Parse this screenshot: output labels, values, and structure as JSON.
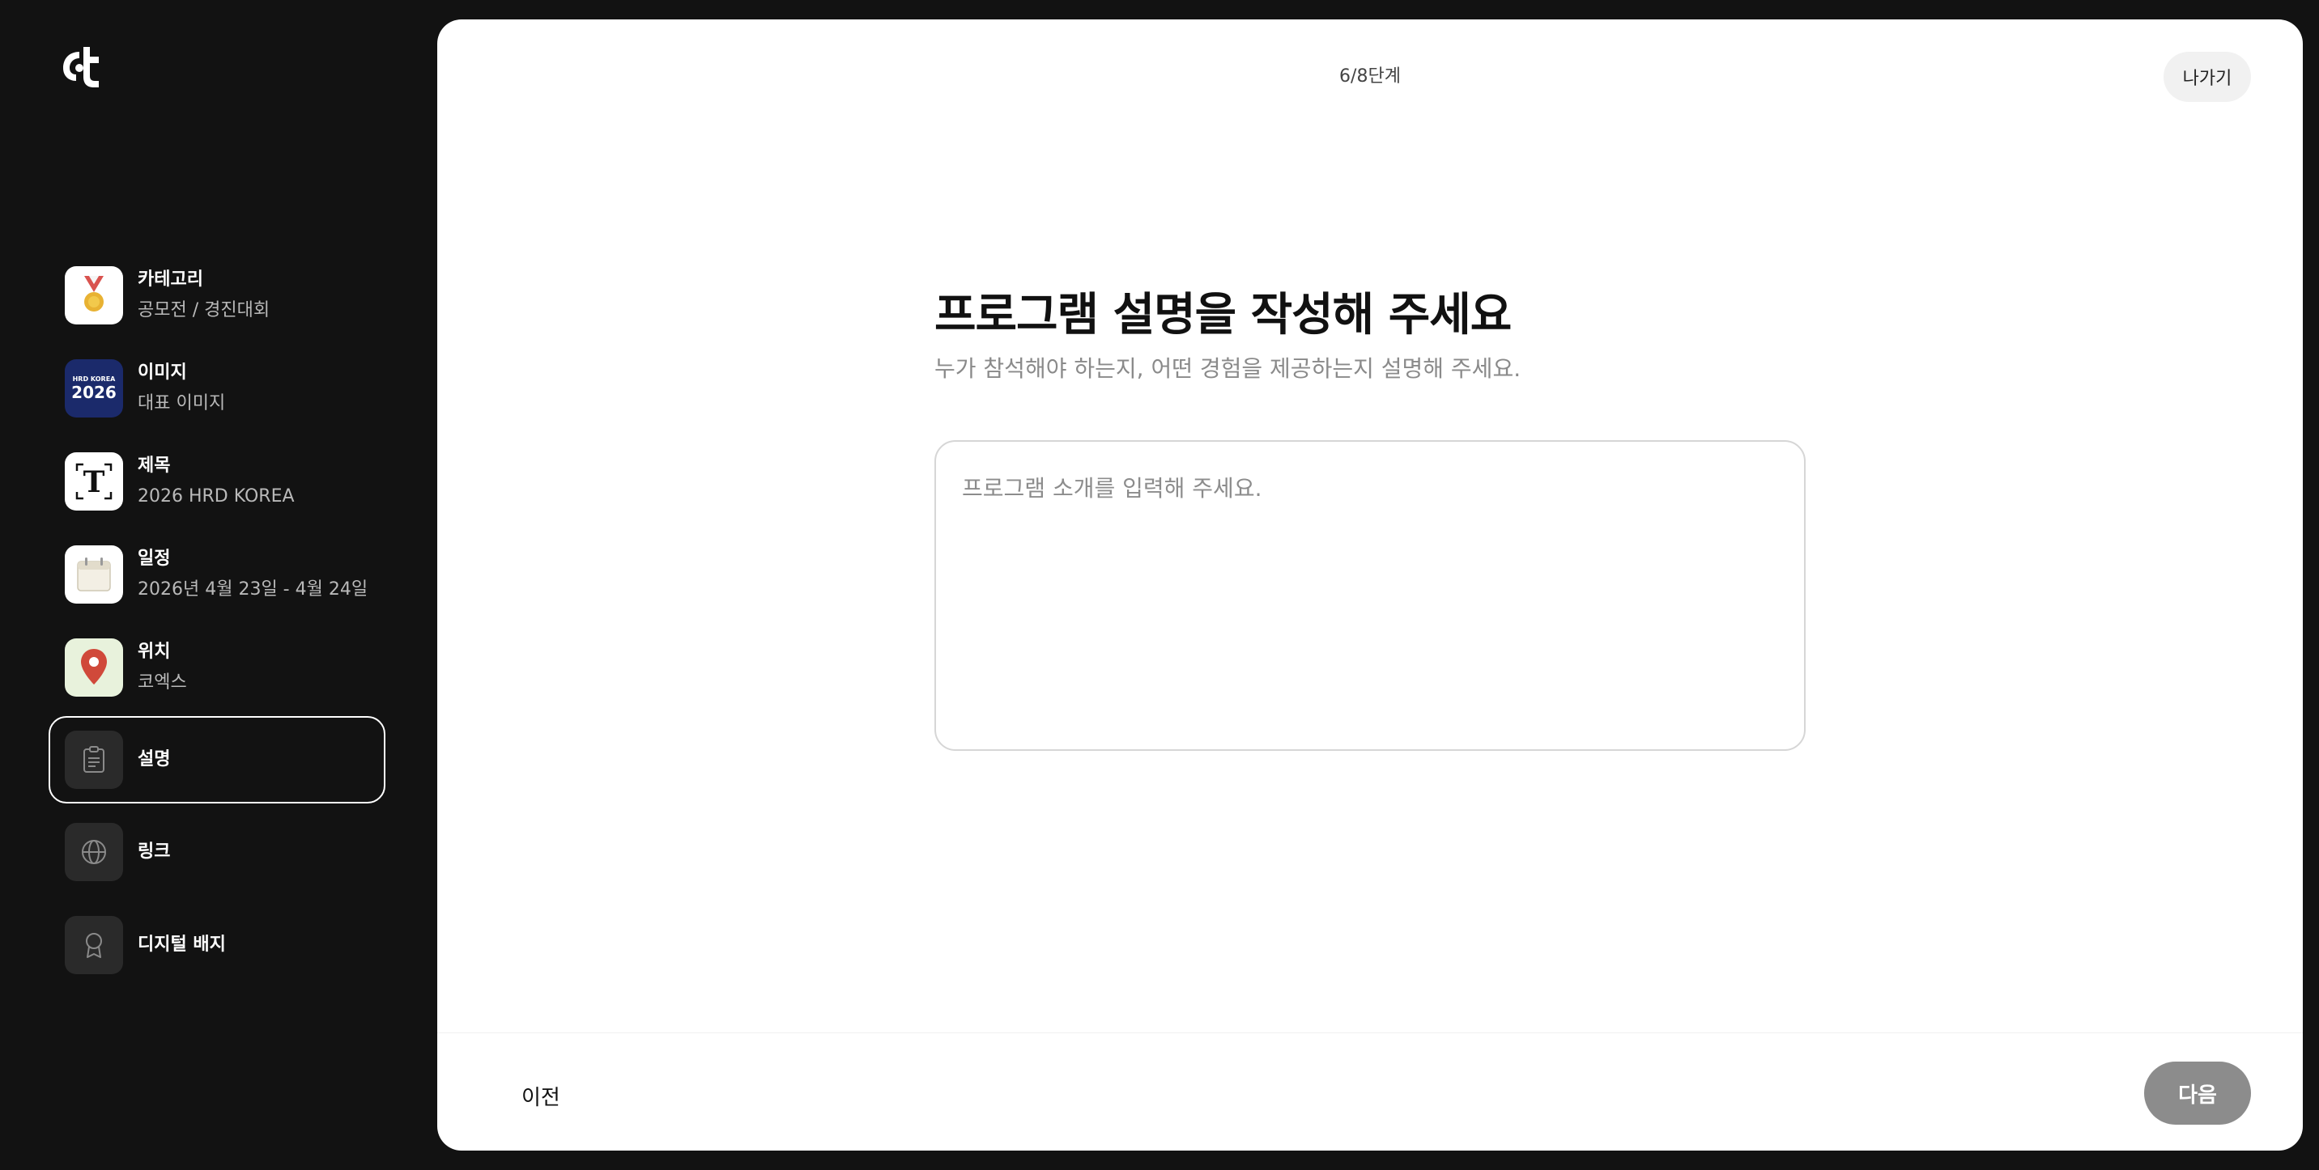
{
  "sidebar": {
    "steps": [
      {
        "title": "카테고리",
        "value": "공모전 / 경진대회",
        "icon": "medal-icon"
      },
      {
        "title": "이미지",
        "value": "대표 이미지",
        "icon": "event-poster-thumbnail"
      },
      {
        "title": "제목",
        "value": "2026 HRD KOREA",
        "icon": "text-t-icon"
      },
      {
        "title": "일정",
        "value": "2026년 4월 23일 - 4월 24일",
        "icon": "calendar-icon"
      },
      {
        "title": "위치",
        "value": "코엑스",
        "icon": "map-pin-icon"
      },
      {
        "title": "설명",
        "value": "",
        "icon": "clipboard-icon",
        "active": true
      },
      {
        "title": "링크",
        "value": "",
        "icon": "globe-icon"
      },
      {
        "title": "디지털 배지",
        "value": "",
        "icon": "badge-icon"
      }
    ],
    "poster_text": {
      "line1": "HRD KOREA",
      "line2": "2026"
    }
  },
  "header": {
    "progress": "6/8단계",
    "exit_label": "나가기"
  },
  "main": {
    "heading": "프로그램 설명을 작성해 주세요",
    "subheading": "누가 참석해야 하는지, 어떤 경험을 제공하는지 설명해 주세요.",
    "description_placeholder": "프로그램 소개를 입력해 주세요.",
    "description_value": ""
  },
  "footer": {
    "prev_label": "이전",
    "next_label": "다음"
  },
  "colors": {
    "background": "#121212",
    "panel": "#ffffff",
    "next_button_disabled": "#8c8c8c"
  }
}
